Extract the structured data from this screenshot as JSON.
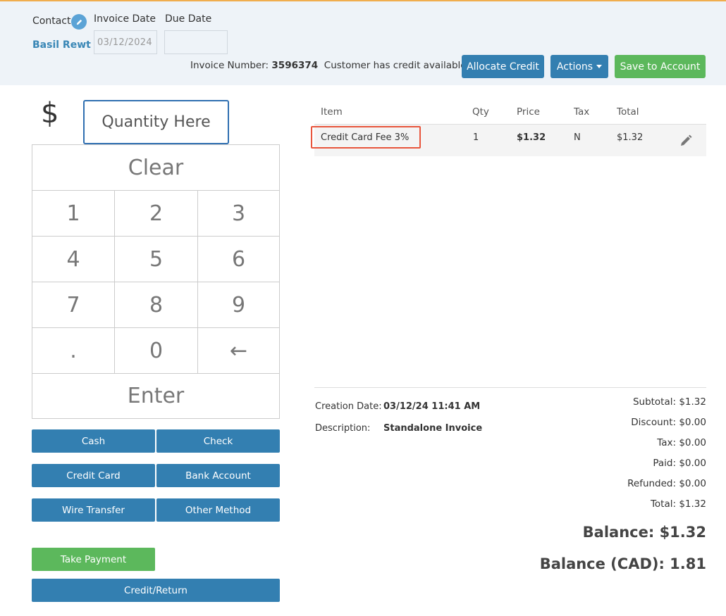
{
  "header": {
    "contact_label": "Contact",
    "contact_name": "Basil Rewt",
    "invoice_date_label": "Invoice Date",
    "invoice_date_value": "03/12/2024",
    "due_date_label": "Due Date",
    "due_date_value": "",
    "invoice_number_label": "Invoice Number:",
    "invoice_number": "3596374",
    "credit_notice": "Customer has credit available.",
    "allocate_credit": "Allocate Credit",
    "actions": "Actions",
    "save_to_account": "Save to Account"
  },
  "keypad": {
    "currency_symbol": "$",
    "quantity_placeholder": "Quantity Here",
    "clear": "Clear",
    "keys": [
      "1",
      "2",
      "3",
      "4",
      "5",
      "6",
      "7",
      "8",
      "9",
      ".",
      "0",
      "←"
    ],
    "enter": "Enter"
  },
  "payment_methods": {
    "cash": "Cash",
    "check": "Check",
    "credit_card": "Credit Card",
    "bank_account": "Bank Account",
    "wire_transfer": "Wire Transfer",
    "other_method": "Other Method",
    "take_payment": "Take Payment",
    "credit_return": "Credit/Return"
  },
  "table": {
    "columns": [
      "Item",
      "Qty",
      "Price",
      "Tax",
      "Total"
    ],
    "rows": [
      {
        "item": "Credit Card Fee 3%",
        "qty": "1",
        "price": "$1.32",
        "tax": "N",
        "total": "$1.32"
      }
    ]
  },
  "details": {
    "creation_date_label": "Creation Date:",
    "creation_date": "03/12/24 11:41 AM",
    "description_label": "Description:",
    "description": "Standalone Invoice"
  },
  "totals": {
    "subtotal": "Subtotal: $1.32",
    "discount": "Discount: $0.00",
    "tax": "Tax: $0.00",
    "paid": "Paid: $0.00",
    "refunded": "Refunded: $0.00",
    "total": "Total: $1.32",
    "balance": "Balance: $1.32",
    "balance_cad": "Balance (CAD): 1.81"
  },
  "colors": {
    "primary": "#337fb1",
    "success": "#5cb85c",
    "highlight": "#e8553c",
    "header_bg": "#eef3f8"
  }
}
